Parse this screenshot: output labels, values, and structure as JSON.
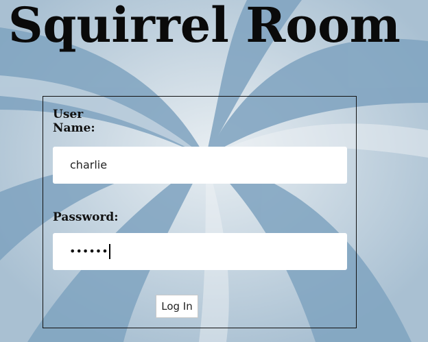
{
  "page": {
    "title": "Squirrel Room"
  },
  "login_form": {
    "username_label": "User Name:",
    "username_value": "charlie",
    "password_label": "Password:",
    "password_mask": "••••••",
    "login_button_label": "Log In"
  },
  "colors": {
    "background_blue": "#8fb0c8",
    "background_light": "#dde6ec",
    "title_text": "#0a0a0a",
    "field_bg": "#ffffff"
  },
  "icons": {
    "background": "swirl-background"
  }
}
